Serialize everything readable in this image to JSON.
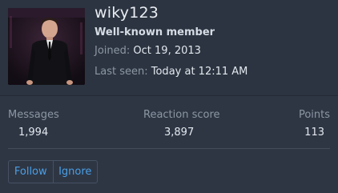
{
  "profile": {
    "username": "wiky123",
    "title": "Well-known member",
    "joined_label": "Joined:",
    "joined_value": "Oct 19, 2013",
    "last_seen_label": "Last seen:",
    "last_seen_value": "Today at 12:11 AM"
  },
  "stats": {
    "messages_label": "Messages",
    "messages_value": "1,994",
    "reaction_label": "Reaction score",
    "reaction_value": "3,897",
    "points_label": "Points",
    "points_value": "113"
  },
  "actions": {
    "follow_label": "Follow",
    "ignore_label": "Ignore"
  },
  "colors": {
    "background": "#2c3441",
    "link": "#4a9fe5",
    "muted_text": "#8c96a3"
  }
}
